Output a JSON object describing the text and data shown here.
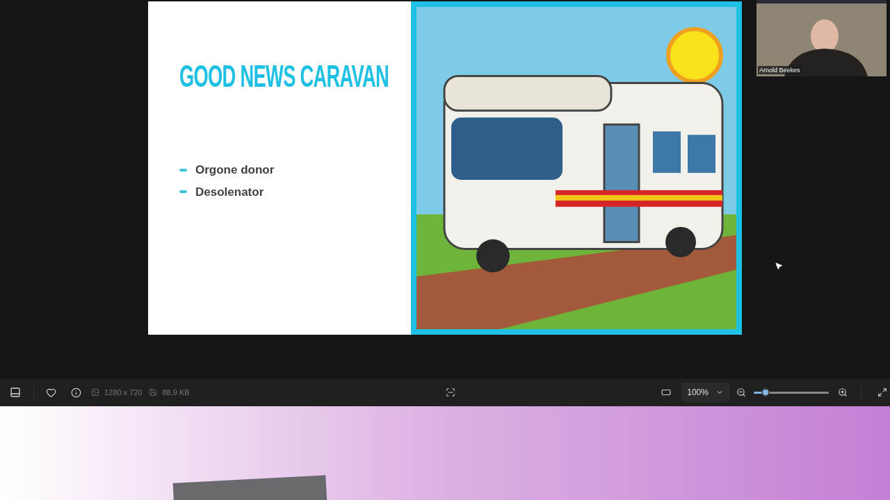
{
  "slide": {
    "title": "GOOD NEWS CARAVAN",
    "bullets": [
      "Orgone donor",
      "Desolenator"
    ]
  },
  "video_tile": {
    "name": "Arnold Beekes"
  },
  "toolbar": {
    "dimensions": "1280 x 720",
    "file_size": "88.9 KB",
    "zoom": "100%",
    "zoom_slider": {
      "level": 0.16
    }
  }
}
